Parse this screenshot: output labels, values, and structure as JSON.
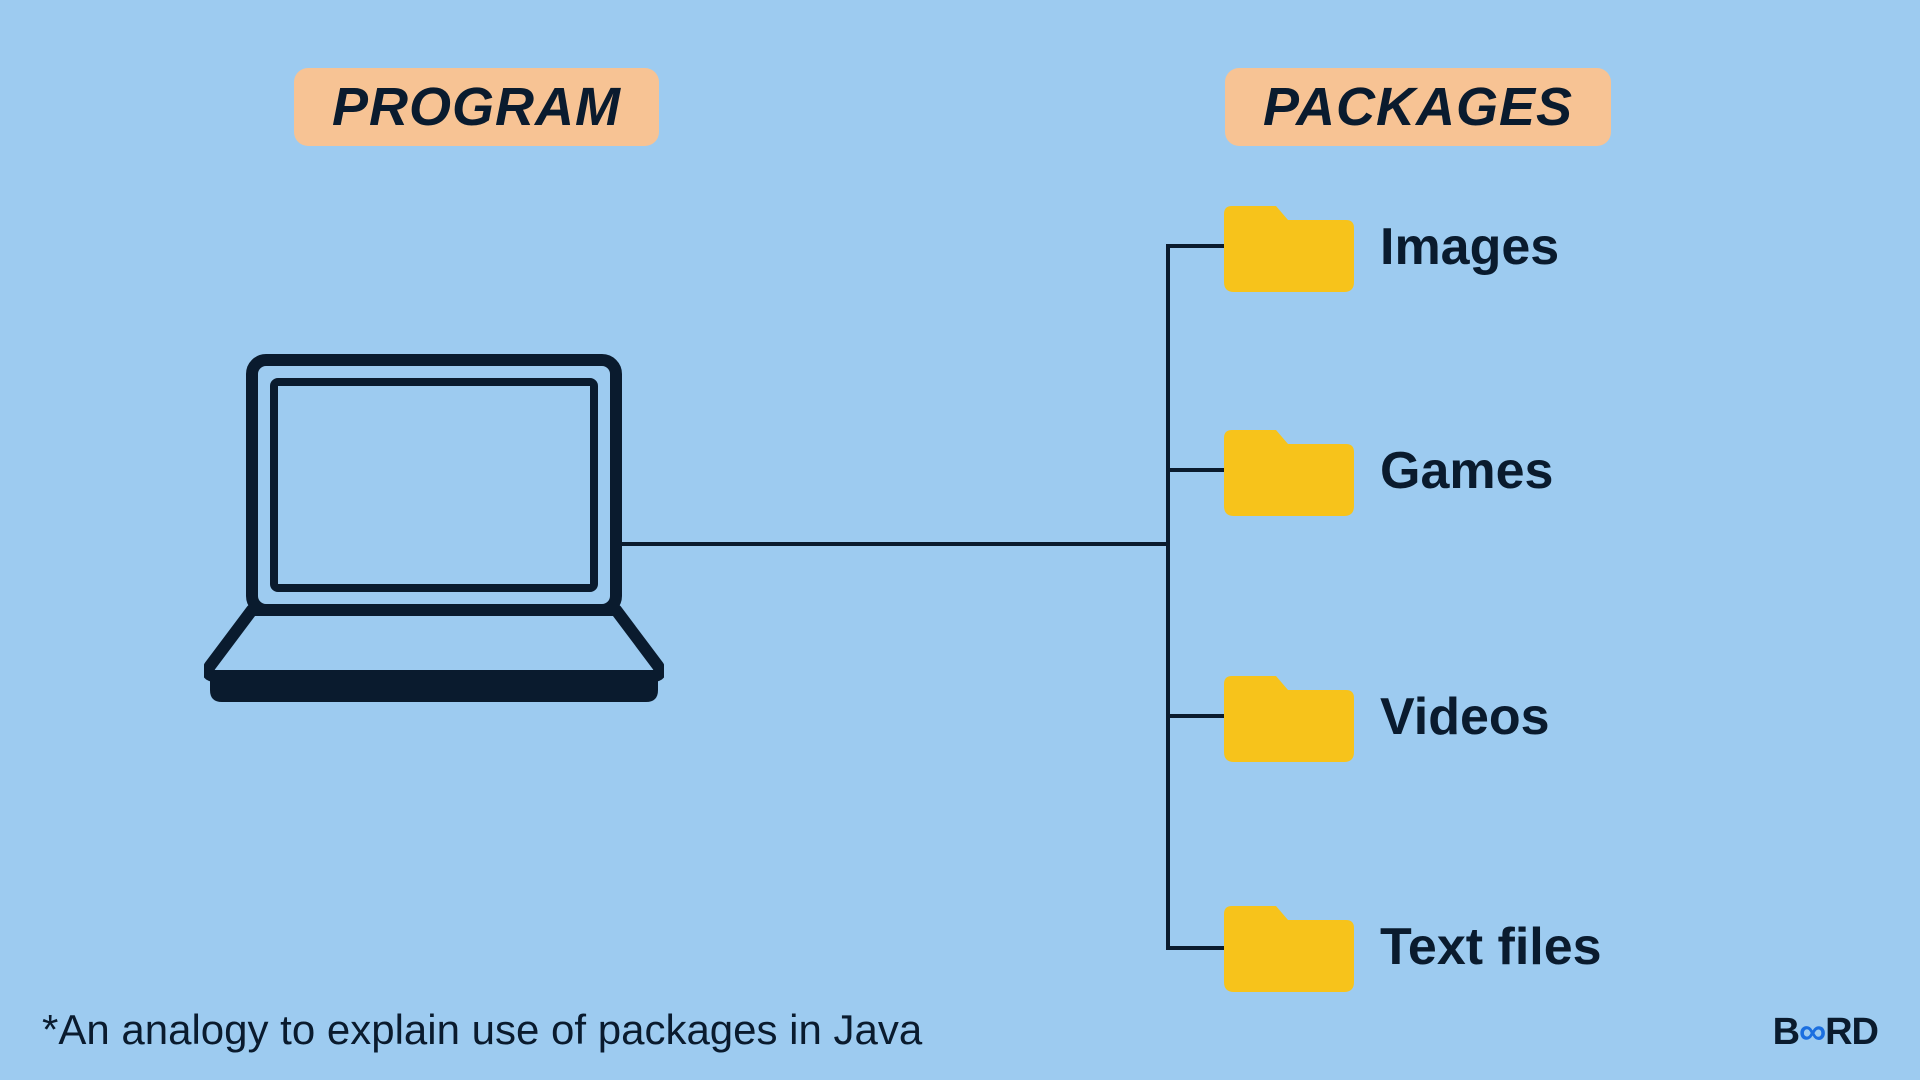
{
  "pills": {
    "program": "PROGRAM",
    "packages": "PACKAGES"
  },
  "folders": [
    {
      "label": "Images"
    },
    {
      "label": "Games"
    },
    {
      "label": "Videos"
    },
    {
      "label": "Text files"
    }
  ],
  "caption": "*An analogy to explain use of packages in Java",
  "brand": {
    "prefix": "B",
    "mid": "∞",
    "suffix": "RD"
  },
  "colors": {
    "bg": "#9dcbf0",
    "pill": "#f7c394",
    "folder": "#f7c31b",
    "ink": "#0a1b2e",
    "accent": "#1b6fe0"
  }
}
